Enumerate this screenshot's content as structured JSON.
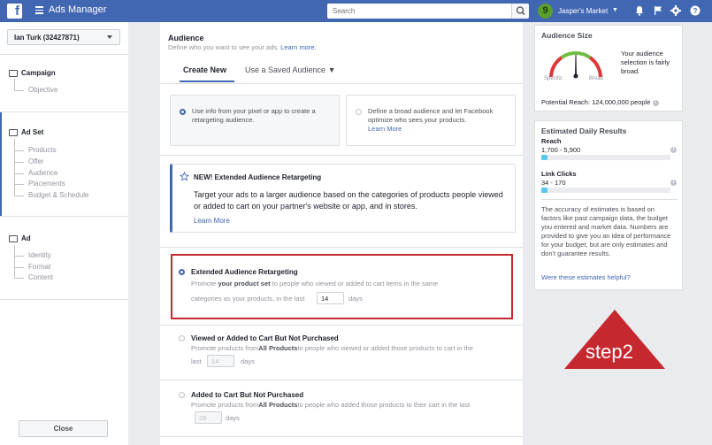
{
  "topbar": {
    "logo": "f",
    "title": "Ads Manager",
    "search_placeholder": "Search",
    "account_initial": "9",
    "account_name": "Jasper's Market",
    "account_chevron": "▼"
  },
  "left": {
    "account_selector": "Ian Turk (32427871)",
    "campaign": {
      "label": "Campaign",
      "items": [
        "Objective"
      ]
    },
    "adset": {
      "label": "Ad Set",
      "items": [
        "Products",
        "Offer",
        "Audience",
        "Placements",
        "Budget & Schedule"
      ]
    },
    "ad": {
      "label": "Ad",
      "items": [
        "Identity",
        "Format",
        "Content"
      ]
    },
    "close": "Close"
  },
  "audience": {
    "title": "Audience",
    "subtitle": "Define who you want to see your ads.",
    "learn_more": "Learn more.",
    "tabs": [
      "Create New",
      "Use a Saved Audience"
    ],
    "tab_caret": "▼",
    "option1": "Use info from your pixel or app to create a retargeting audience.",
    "option2": "Define a broad audience and let Facebook optimize who sees your products.",
    "option2_link": "Learn More",
    "promo": {
      "title": "NEW! Extended Audience Retargeting",
      "body": "Target your ads to a larger audience based on the categories of products people viewed or added to cart on your partner's website or app, and in stores.",
      "link": "Learn More"
    },
    "choices": [
      {
        "title": "Extended Audience Retargeting",
        "desc_pre": "Promote ",
        "desc_bold": "your product set",
        "desc_post": " to people who viewed or added to cart items in the same",
        "desc_line2": "categories as your products, in the last",
        "days": "14",
        "unit": "days",
        "selected": true
      },
      {
        "title": "Viewed or Added to Cart But Not Purchased",
        "desc_pre": "Promote products from",
        "desc_bold": "All Products",
        "desc_post": "to people who viewed or added those products to cart in the",
        "desc_line2": "last",
        "days": "14",
        "unit": "days",
        "selected": false
      },
      {
        "title": "Added to Cart But Not Purchased",
        "desc_pre": "Promote products from",
        "desc_bold": "All Products",
        "desc_post": "to people who added those products to their cart in the last",
        "desc_line2": "",
        "days": "28",
        "unit": "days",
        "selected": false
      }
    ]
  },
  "audience_size": {
    "title": "Audience Size",
    "specific": "Specific",
    "broad": "Broad",
    "status": "Your audience selection is fairly broad.",
    "potential_reach": "Potential Reach: 124,000,000 people",
    "info": "i"
  },
  "estimated": {
    "title": "Estimated Daily Results",
    "reach_label": "Reach",
    "reach_value": "1,700 - 5,900",
    "reach_fill": 0.05,
    "clicks_label": "Link Clicks",
    "clicks_value": "34 - 170",
    "clicks_fill": 0.05,
    "note": "The accuracy of estimates is based on factors like past campaign data, the budget you entered and market data. Numbers are provided to give you an idea of performance for your budget, but are only estimates and don't guarantee results.",
    "helpful": "Were these estimates helpful?"
  },
  "annotation": {
    "label": "step2",
    "color": "#c5282f"
  }
}
